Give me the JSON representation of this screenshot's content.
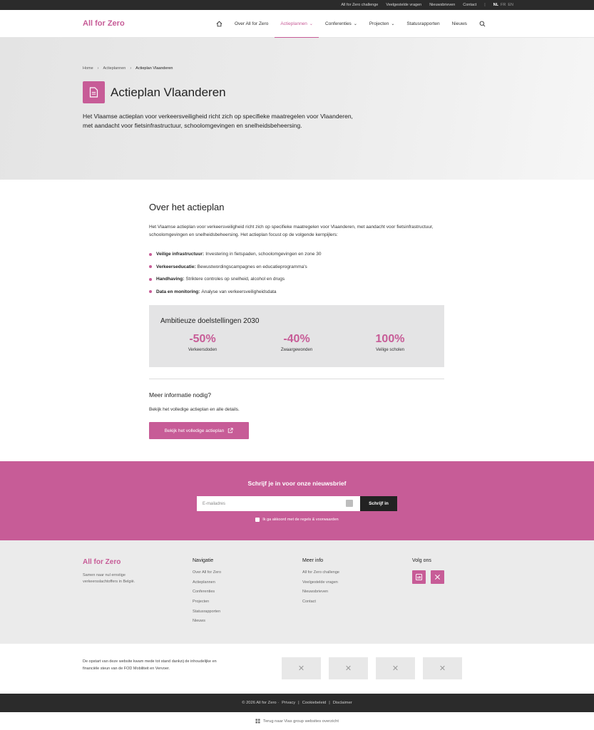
{
  "topbar": {
    "links": [
      "All for Zero challenge",
      "Veelgestelde vragen",
      "Nieuwsbrieven",
      "Contact"
    ],
    "lang_active": "NL",
    "langs": [
      "FR",
      "EN"
    ]
  },
  "header": {
    "logo": "All for Zero",
    "nav": [
      {
        "label": "Over All for Zero"
      },
      {
        "label": "Actieplannen"
      },
      {
        "label": "Conferenties"
      },
      {
        "label": "Projecten"
      },
      {
        "label": "Statusrapporten"
      },
      {
        "label": "Nieuws"
      }
    ]
  },
  "hero": {
    "breadcrumb": [
      "Home",
      "Actieplannen",
      "Actieplan Vlaanderen"
    ],
    "title": "Actieplan Vlaanderen",
    "description": "Het Vlaamse actieplan voor verkeersveiligheid richt zich op specifieke maatregelen voor Vlaanderen, met aandacht voor fietsinfrastructuur, schoolomgevingen en snelheidsbeheersing."
  },
  "about": {
    "title": "Over het actieplan",
    "intro": "Het Vlaamse actieplan voor verkeersveiligheid richt zich op specifieke maatregelen voor Vlaanderen, met aandacht voor fietsinfrastructuur, schoolomgevingen en snelheidsbeheersing. Het actieplan focust op de volgende kernpijlers:",
    "pillars": [
      {
        "term": "Veilige infrastructuur:",
        "text": "Investering in fietspaden, schoolomgevingen en zone 30"
      },
      {
        "term": "Verkeerseducatie:",
        "text": "Bewustwordingscampagnes en educatieprogramma's"
      },
      {
        "term": "Handhaving:",
        "text": "Striktere controles op snelheid, alcohol en drugs"
      },
      {
        "term": "Data en monitoring:",
        "text": "Analyse van verkeersveiligheidsdata"
      }
    ]
  },
  "goals": {
    "title": "Ambitieuze doelstellingen 2030",
    "items": [
      {
        "value": "-50%",
        "label": "Verkeersdoden"
      },
      {
        "value": "-40%",
        "label": "Zwaargewonden"
      },
      {
        "value": "100%",
        "label": "Veilige scholen"
      }
    ]
  },
  "more": {
    "title": "Meer informatie nodig?",
    "text": "Bekijk het volledige actieplan en alle details.",
    "button": "Bekijk het volledige actieplan"
  },
  "newsletter": {
    "title": "Schrijf je in voor onze nieuwsbrief",
    "placeholder": "E-mailadres",
    "button": "Schrijf in",
    "consent": "Ik ga akkoord met de regels & voorwaarden"
  },
  "footer": {
    "logo": "All for Zero",
    "tagline": "Samen naar nul ernstige verkeersslachtoffers in België.",
    "navigation": {
      "title": "Navigatie",
      "links": [
        "Over All for Zero",
        "Actieplannen",
        "Conferenties",
        "Projecten",
        "Statusrapporten",
        "Nieuws"
      ]
    },
    "more_info": {
      "title": "Meer info",
      "links": [
        "All for Zero challenge",
        "Veelgestelde vragen",
        "Nieuwsbrieven",
        "Contact"
      ]
    },
    "follow": {
      "title": "Volg ons"
    }
  },
  "partners": {
    "text": "De opstart van deze website kwam mede tot stand dankzij de inhoudelijke en financiële steun van de FOD Mobiliteit en Vervoer."
  },
  "bottombar": {
    "copyright": "© 2026 All for Zero ·",
    "links": [
      "Privacy",
      "Cookiebeleid",
      "Disclaimer"
    ]
  },
  "backlink": "Terug naar Vias group websites overzicht",
  "colors": {
    "accent": "#c75c97",
    "dark": "#2b2b2b",
    "footer_bg": "#ebebeb"
  }
}
